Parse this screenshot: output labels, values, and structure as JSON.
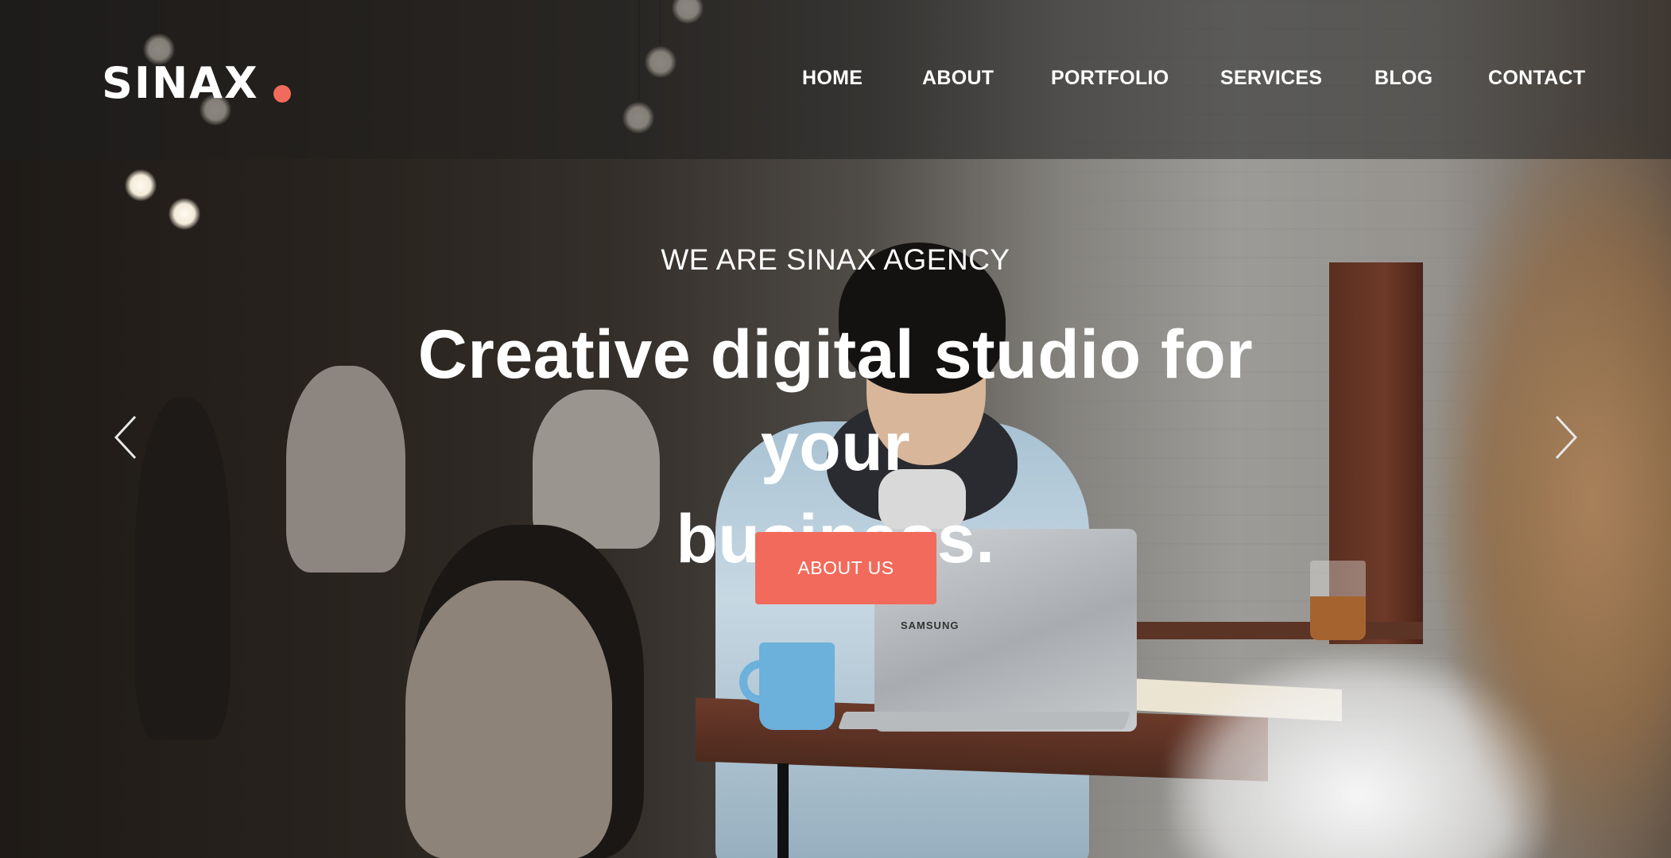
{
  "brand": {
    "name": "SINAX",
    "accent_color": "#f26a5b"
  },
  "nav": {
    "items": [
      {
        "label": "HOME"
      },
      {
        "label": "ABOUT"
      },
      {
        "label": "PORTFOLIO"
      },
      {
        "label": "SERVICES"
      },
      {
        "label": "BLOG"
      },
      {
        "label": "CONTACT"
      }
    ]
  },
  "hero": {
    "eyebrow": "WE ARE SINAX AGENCY",
    "headline_line1": "Creative digital studio for your",
    "headline_line2": "business.",
    "cta_label": "ABOUT US",
    "prev_icon": "chevron-left-icon",
    "next_icon": "chevron-right-icon",
    "background_image": "person working on laptop in café",
    "laptop_brand": "SAMSUNG"
  }
}
